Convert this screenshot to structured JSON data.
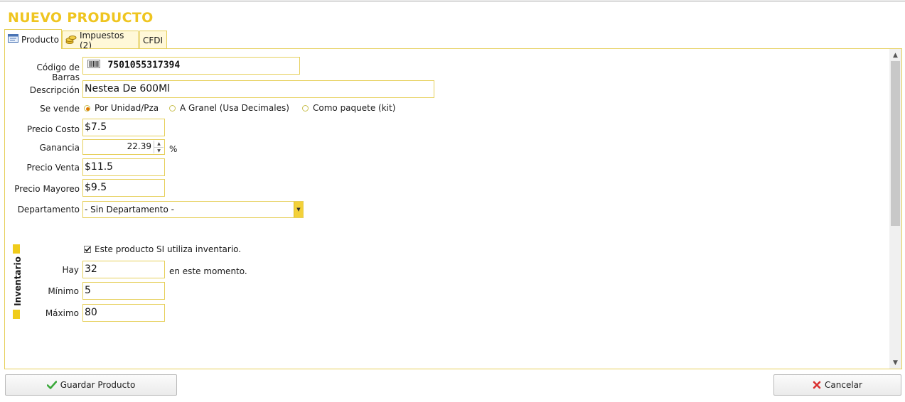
{
  "header": {
    "title": "NUEVO PRODUCTO"
  },
  "tabs": [
    {
      "label": "Producto",
      "icon": "form-icon",
      "active": true
    },
    {
      "label": "Impuestos (2)",
      "icon": "coins-icon",
      "active": false
    },
    {
      "label": "CFDI",
      "active": false
    }
  ],
  "form": {
    "barcode": {
      "label": "Código de Barras",
      "value": "7501055317394",
      "icon": "barcode-icon"
    },
    "description": {
      "label": "Descripción",
      "value": "Nestea De 600Ml"
    },
    "sale_type": {
      "label": "Se vende",
      "options": [
        {
          "label": "Por Unidad/Pza",
          "selected": true
        },
        {
          "label": "A Granel (Usa Decimales)",
          "selected": false
        },
        {
          "label": "Como paquete (kit)",
          "selected": false
        }
      ]
    },
    "cost_price": {
      "label": "Precio Costo",
      "value": "$7.5"
    },
    "profit": {
      "label": "Ganancia",
      "value": "22.39",
      "unit": "%"
    },
    "sale_price": {
      "label": "Precio Venta",
      "value": "$11.5"
    },
    "wholesale_price": {
      "label": "Precio Mayoreo",
      "value": "$9.5"
    },
    "department": {
      "label": "Departamento",
      "value": "- Sin Departamento -"
    }
  },
  "inventory": {
    "section_label": "Inventario",
    "uses_inventory": {
      "label": "Este producto SI utiliza inventario.",
      "checked": true
    },
    "current": {
      "label": "Hay",
      "value": "32",
      "suffix": "en este momento."
    },
    "minimum": {
      "label": "Mínimo",
      "value": "5"
    },
    "maximum": {
      "label": "Máximo",
      "value": "80"
    }
  },
  "actions": {
    "save_label": "Guardar Producto",
    "cancel_label": "Cancelar"
  },
  "colors": {
    "accent": "#efc520",
    "border": "#e6cf5a",
    "check_green": "#3aa83a",
    "cancel_red": "#d93030"
  }
}
